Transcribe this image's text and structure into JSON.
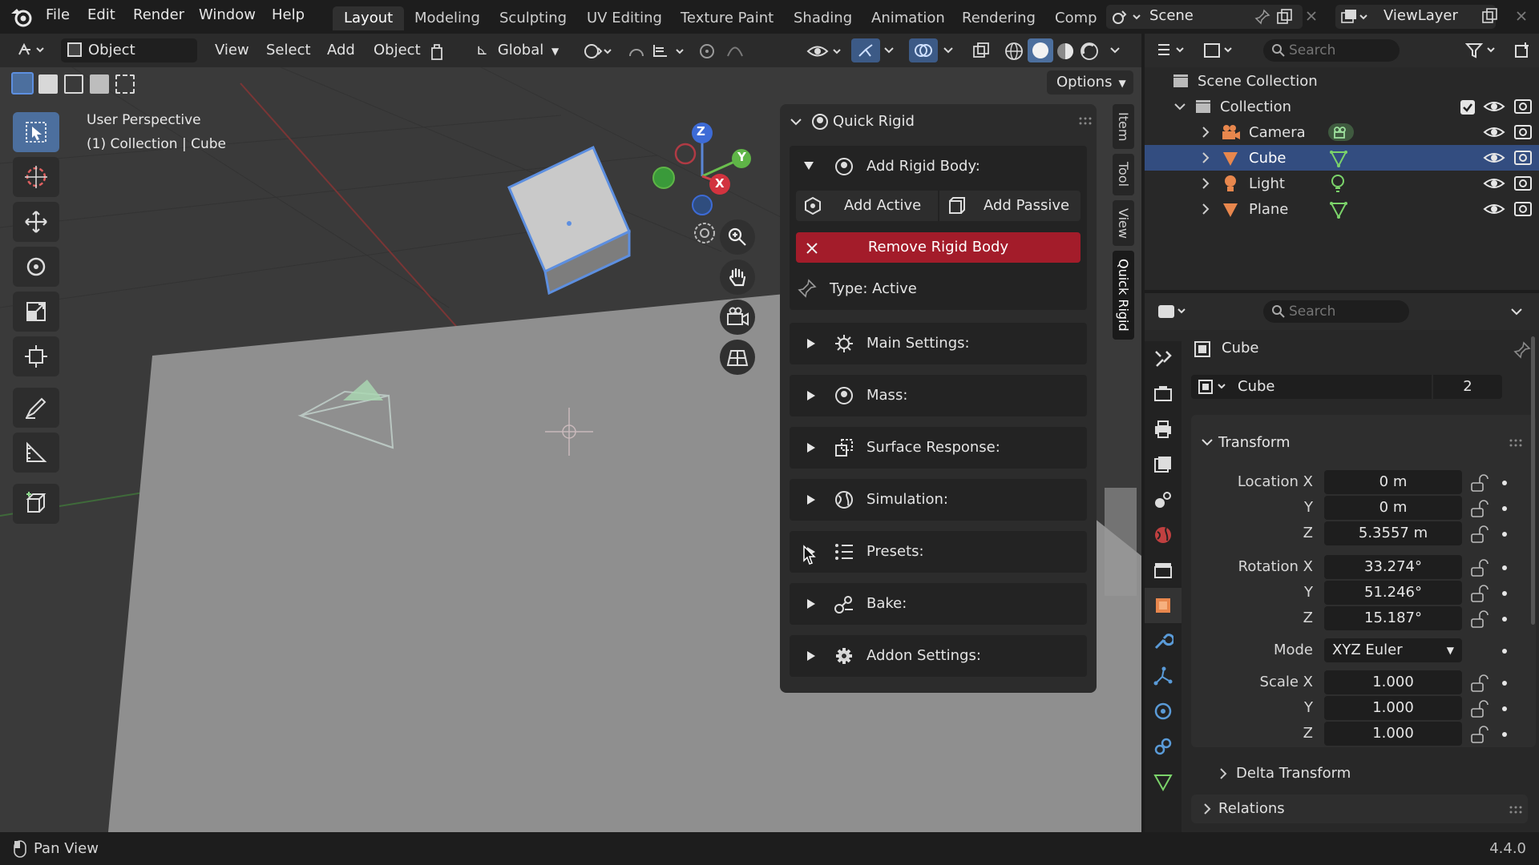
{
  "menu": {
    "file": "File",
    "edit": "Edit",
    "render": "Render",
    "window": "Window",
    "help": "Help"
  },
  "workspaces": [
    "Layout",
    "Modeling",
    "Sculpting",
    "UV Editing",
    "Texture Paint",
    "Shading",
    "Animation",
    "Rendering",
    "Comp"
  ],
  "scene": {
    "name": "Scene",
    "view_layer": "ViewLayer"
  },
  "header": {
    "mode": "Object Mode",
    "view": "View",
    "select": "Select",
    "add": "Add",
    "object": "Object",
    "transform_orientation": "Global",
    "options": "Options"
  },
  "viewport": {
    "perspective": "User Perspective",
    "collection_info": "(1) Collection | Cube"
  },
  "gizmo": {
    "z": "Z",
    "y": "Y",
    "x": "X"
  },
  "quick_rigid": {
    "title": "Quick Rigid",
    "add_rigid_body": "Add Rigid Body:",
    "add_active": "Add Active",
    "add_passive": "Add Passive",
    "remove": "Remove Rigid Body",
    "type": "Type: Active",
    "sections": [
      "Main Settings:",
      "Mass:",
      "Surface Response:",
      "Simulation:",
      "Presets:",
      "Bake:",
      "Addon Settings:"
    ]
  },
  "side_tabs": [
    "Item",
    "Tool",
    "View",
    "Quick Rigid"
  ],
  "outliner": {
    "search_placeholder": "Search",
    "scene_collection": "Scene Collection",
    "collection": "Collection",
    "items": [
      "Camera",
      "Cube",
      "Light",
      "Plane"
    ]
  },
  "properties": {
    "search_placeholder": "Search",
    "object_name": "Cube",
    "data_name": "Cube",
    "users": "2",
    "transform": "Transform",
    "location_x_label": "Location X",
    "rotation_x_label": "Rotation X",
    "scale_x_label": "Scale X",
    "y_label": "Y",
    "z_label": "Z",
    "mode_label": "Mode",
    "location": [
      "0 m",
      "0 m",
      "5.3557 m"
    ],
    "rotation": [
      "33.274°",
      "51.246°",
      "15.187°"
    ],
    "mode": "XYZ Euler",
    "scale": [
      "1.000",
      "1.000",
      "1.000"
    ],
    "delta_transform": "Delta Transform",
    "relations": "Relations"
  },
  "status": {
    "hint": "Pan View",
    "version": "4.4.0"
  },
  "colors": {
    "accent": "#4c6f9e",
    "selection": "#334d80",
    "remove": "#a31c2a",
    "object_orange": "#e8874d",
    "mesh_green": "#7bd36a"
  }
}
